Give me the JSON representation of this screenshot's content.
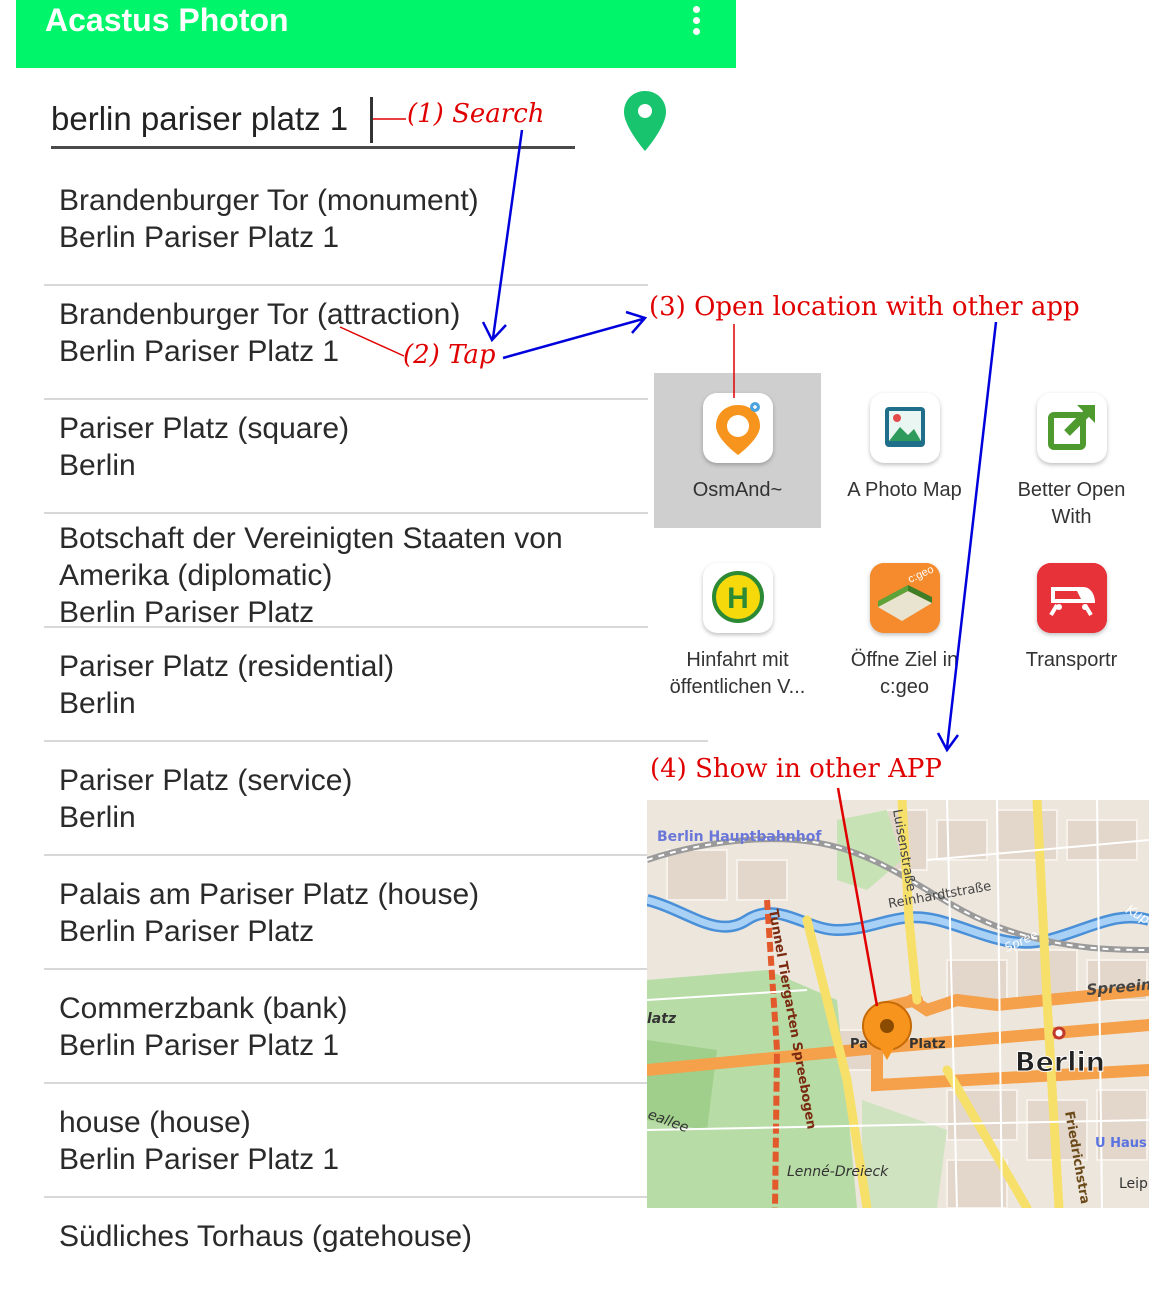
{
  "app": {
    "title": "Acastus Photon",
    "menu_icon": "overflow-menu-icon"
  },
  "search": {
    "value": "berlin pariser platz 1",
    "icon": "location-pin-icon",
    "pin_color": "#19c46e"
  },
  "results": [
    {
      "name": "Brandenburger Tor (monument)",
      "address": "Berlin Pariser Platz 1"
    },
    {
      "name": "Brandenburger Tor (attraction)",
      "address": "Berlin Pariser Platz 1"
    },
    {
      "name": "Pariser Platz (square)",
      "address": "Berlin"
    },
    {
      "name": "Botschaft der Vereinigten Staaten von",
      "name2": "Amerika (diplomatic)",
      "address": "Berlin Pariser Platz"
    },
    {
      "name": "Pariser Platz (residential)",
      "address": "Berlin"
    },
    {
      "name": "Pariser Platz (service)",
      "address": "Berlin"
    },
    {
      "name": "Palais am Pariser Platz (house)",
      "address": "Berlin Pariser Platz"
    },
    {
      "name": "Commerzbank (bank)",
      "address": "Berlin Pariser Platz 1"
    },
    {
      "name": "house (house)",
      "address": "Berlin Pariser Platz 1"
    },
    {
      "name": "Südliches Torhaus (gatehouse)"
    }
  ],
  "share_apps": [
    {
      "label": "OsmAnd~",
      "icon": "osmand-icon",
      "selected": true
    },
    {
      "label": "A Photo Map",
      "icon": "photo-map-icon"
    },
    {
      "label": "Better Open",
      "label2": "With",
      "icon": "better-open-with-icon"
    },
    {
      "label": "Hinfahrt mit",
      "label2": "öffentlichen V...",
      "icon": "bus-stop-h-icon"
    },
    {
      "label": "Öffne Ziel in",
      "label2": "c:geo",
      "icon": "cgeo-icon"
    },
    {
      "label": "Transportr",
      "icon": "transportr-train-icon"
    }
  ],
  "annotations": {
    "search": "(1) Search",
    "tap": "(2) Tap",
    "open": "(3)  Open  location  with  other  app",
    "show": "(4)  Show  in  other  APP"
  },
  "map": {
    "labels": {
      "hbf": "Berlin Hauptbahnhof",
      "luisen": "Luisenstraße",
      "reinhardt": "Reinhardtstraße",
      "tunnel": "Tunnel Tiergarten Spreebogen",
      "spree": "Spree",
      "spreein": "Spreein",
      "kup": "Kup",
      "platz": "Platz",
      "pa": "Pa",
      "latz": "latz",
      "berlin": "Berlin",
      "eallee": "eallee",
      "lenne": "Lenné-Dreieck",
      "friedrich": "Friedrichstra",
      "uhaus": "U Haus",
      "leip": "Leip"
    }
  },
  "colors": {
    "appbar": "#00f56a",
    "annotation_red": "#e00000",
    "arrow_blue": "#0000dd"
  }
}
